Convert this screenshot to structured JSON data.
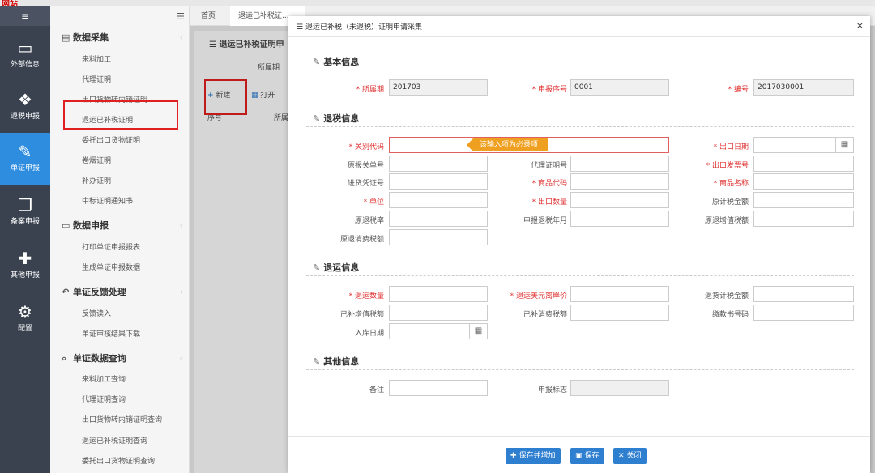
{
  "app": {
    "logo_fragment": "网站"
  },
  "leftnav": {
    "items": [
      {
        "label": "外部信息",
        "icon": "drive-icon"
      },
      {
        "label": "退税申报",
        "icon": "cubes-icon"
      },
      {
        "label": "单证申报",
        "icon": "edit-icon"
      },
      {
        "label": "备案申报",
        "icon": "copy-icon"
      },
      {
        "label": "其他申报",
        "icon": "puzzle-icon"
      },
      {
        "label": "配置",
        "icon": "gears-icon"
      }
    ]
  },
  "sidebar": {
    "sections": [
      {
        "title": "数据采集",
        "items": [
          "来料加工",
          "代理证明",
          "出口货物转内销证明",
          "退运已补税证明",
          "委托出口货物证明",
          "卷烟证明",
          "补办证明",
          "中标证明通知书"
        ]
      },
      {
        "title": "数据申报",
        "items": [
          "打印单证申报报表",
          "生成单证申报数据"
        ]
      },
      {
        "title": "单证反馈处理",
        "items": [
          "反馈读入",
          "单证审核结果下载"
        ]
      },
      {
        "title": "单证数据查询",
        "items": [
          "来料加工查询",
          "代理证明查询",
          "出口货物转内销证明查询",
          "退运已补税证明查询",
          "委托出口货物证明查询"
        ]
      }
    ]
  },
  "tabs": [
    {
      "label": "首页"
    },
    {
      "label": "退运已补税证..."
    }
  ],
  "bg": {
    "panel_title": "退运已补税证明申",
    "period_label": "所属期",
    "new_label": "新建",
    "open_label": "打开",
    "col_seq": "序号",
    "col_period": "所属"
  },
  "modal": {
    "title": "退运已补税（未退税）证明申请采集",
    "close": "×",
    "groups": {
      "basic": "基本信息",
      "tax": "退税信息",
      "return": "退运信息",
      "other": "其他信息"
    },
    "basic": {
      "period_label": "所属期",
      "period_value": "201703",
      "seq_label": "申报序号",
      "seq_value": "0001",
      "no_label": "编号",
      "no_value": "2017030001"
    },
    "tax": {
      "customs_code": "关别代码",
      "export_date": "出口日期",
      "orig_decl_no": "原报关单号",
      "agent_cert_no": "代理证明号",
      "invoice_no": "出口发票号",
      "voucher_no": "进货凭证号",
      "goods_code": "商品代码",
      "goods_name": "商品名称",
      "unit": "单位",
      "export_qty": "出口数量",
      "orig_tax_amount": "原计税金额",
      "orig_rebate_rate": "原退税率",
      "rebate_month": "申报退税年月",
      "orig_vat": "原退增值税额",
      "orig_consumption": "原退消费税额",
      "tooltip": "该输入项为必录项"
    },
    "ret": {
      "return_qty": "退运数量",
      "return_usd": "退运美元离岸价",
      "return_tax_amount": "退货计税金额",
      "paid_vat": "已补增值税额",
      "paid_consumption": "已补消费税额",
      "payment_no": "缴款书号码",
      "storage_date": "入库日期"
    },
    "other": {
      "remark": "备注",
      "decl_flag": "申报标志"
    },
    "buttons": {
      "save_add": "保存并增加",
      "save": "保存",
      "close": "关闭"
    }
  }
}
